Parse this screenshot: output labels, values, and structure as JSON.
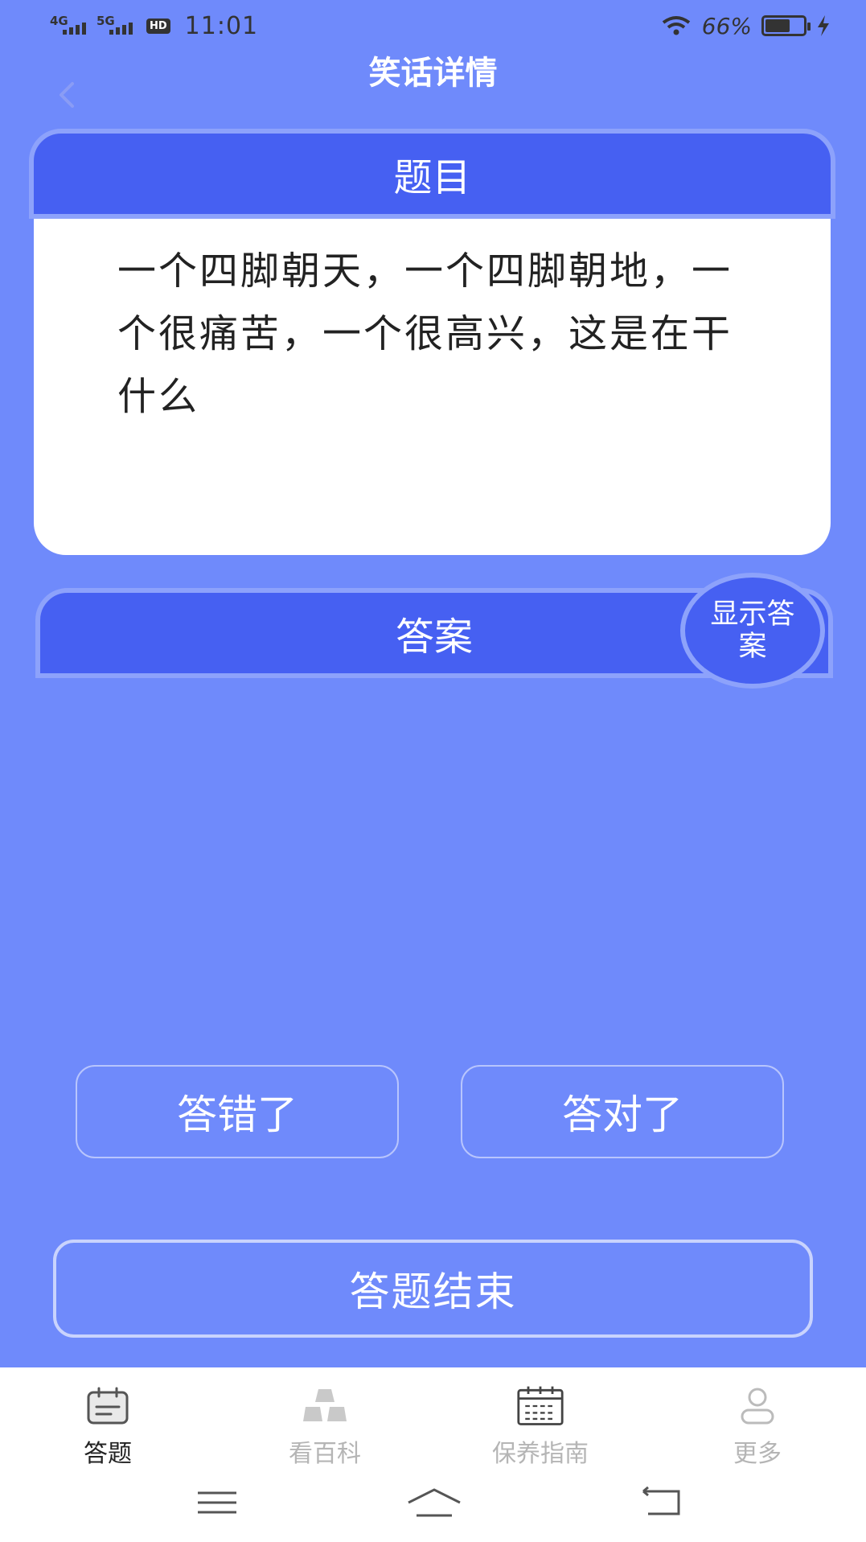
{
  "status_bar": {
    "signal_1": "4G",
    "signal_2": "5G",
    "hd": "HD",
    "time": "11:01",
    "battery_percent": "66%",
    "battery_level": 0.66
  },
  "header": {
    "title": "笑话详情",
    "back_icon": "chevron-left-icon"
  },
  "question": {
    "header": "题目",
    "text": "一个四脚朝天，一个四脚朝地，一个很痛苦，一个很高兴，这是在干什么"
  },
  "answer": {
    "header": "答案",
    "show_button": "显示答案"
  },
  "actions": {
    "wrong": "答错了",
    "right": "答对了",
    "finish": "答题结束"
  },
  "bottom_nav": {
    "items": [
      {
        "label": "答题",
        "icon": "calendar-icon",
        "active": true
      },
      {
        "label": "看百科",
        "icon": "stack-icon",
        "active": false
      },
      {
        "label": "保养指南",
        "icon": "schedule-icon",
        "active": false
      },
      {
        "label": "更多",
        "icon": "user-icon",
        "active": false
      }
    ]
  },
  "colors": {
    "background": "#6f8afb",
    "primary": "#4660f2",
    "border": "#8da2fb",
    "card": "#ffffff"
  }
}
